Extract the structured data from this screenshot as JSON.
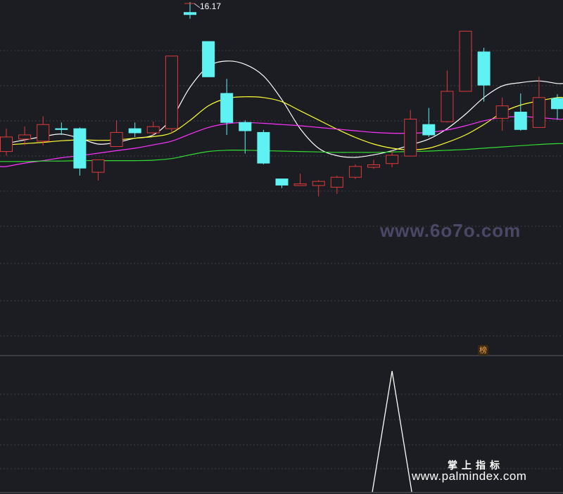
{
  "colors": {
    "background": "#1b1d22",
    "grid": "#3c3f46",
    "up": "#e03a3a",
    "down": "#5ef2f2",
    "ma5": "#ffffff",
    "ma10": "#ffff33",
    "ma20": "#ff33ff",
    "ma60": "#33dd33",
    "signal": "#ffffff"
  },
  "labels": {
    "high_marker": "16.17",
    "badge": "榜",
    "watermark_top": "www.6o7o.com",
    "watermark_cn": "掌上指标",
    "watermark_url": "www.palmindex.com"
  },
  "chart_data": [
    {
      "type": "candlestick",
      "title": "",
      "ylim": [
        7.9,
        16.4
      ],
      "high_label": 16.17,
      "candles": [
        {
          "o": 12.8,
          "c": 13.15,
          "h": 13.35,
          "l": 12.7
        },
        {
          "o": 13.1,
          "c": 13.2,
          "h": 13.4,
          "l": 12.95
        },
        {
          "o": 13.05,
          "c": 13.45,
          "h": 13.65,
          "l": 12.95
        },
        {
          "o": 13.35,
          "c": 13.33,
          "h": 13.5,
          "l": 13.2
        },
        {
          "o": 13.35,
          "c": 12.4,
          "h": 13.38,
          "l": 12.22
        },
        {
          "o": 12.3,
          "c": 12.6,
          "h": 12.6,
          "l": 12.1
        },
        {
          "o": 12.92,
          "c": 13.26,
          "h": 13.55,
          "l": 12.92
        },
        {
          "o": 13.35,
          "c": 13.25,
          "h": 13.5,
          "l": 13.15
        },
        {
          "o": 13.25,
          "c": 13.4,
          "h": 13.52,
          "l": 13.2
        },
        {
          "o": 13.35,
          "c": 15.1,
          "h": 15.1,
          "l": 13.25
        },
        {
          "o": 16.15,
          "c": 16.1,
          "h": 16.4,
          "l": 16.0
        },
        {
          "o": 15.45,
          "c": 14.6,
          "h": 15.45,
          "l": 14.6
        },
        {
          "o": 14.2,
          "c": 13.5,
          "h": 14.55,
          "l": 13.2
        },
        {
          "o": 13.5,
          "c": 13.3,
          "h": 13.55,
          "l": 12.75
        },
        {
          "o": 13.26,
          "c": 12.52,
          "h": 13.32,
          "l": 12.49
        },
        {
          "o": 12.14,
          "c": 11.99,
          "h": 12.14,
          "l": 11.92
        },
        {
          "o": 11.98,
          "c": 12.02,
          "h": 12.27,
          "l": 11.98
        },
        {
          "o": 11.98,
          "c": 12.08,
          "h": 12.11,
          "l": 11.72
        },
        {
          "o": 11.94,
          "c": 12.18,
          "h": 12.22,
          "l": 11.78
        },
        {
          "o": 12.18,
          "c": 12.44,
          "h": 12.49,
          "l": 12.14
        },
        {
          "o": 12.42,
          "c": 12.48,
          "h": 12.6,
          "l": 12.38
        },
        {
          "o": 12.51,
          "c": 12.71,
          "h": 12.82,
          "l": 12.42
        },
        {
          "o": 12.69,
          "c": 13.58,
          "h": 13.8,
          "l": 12.69
        },
        {
          "o": 13.45,
          "c": 13.2,
          "h": 13.85,
          "l": 13.15
        },
        {
          "o": 13.52,
          "c": 14.25,
          "h": 14.75,
          "l": 13.5
        },
        {
          "o": 14.25,
          "c": 15.7,
          "h": 15.7,
          "l": 14.4
        },
        {
          "o": 15.2,
          "c": 14.4,
          "h": 15.3,
          "l": 14.0
        },
        {
          "o": 13.6,
          "c": 13.9,
          "h": 14.1,
          "l": 13.3
        },
        {
          "o": 13.75,
          "c": 13.33,
          "h": 14.2,
          "l": 13.3
        },
        {
          "o": 13.38,
          "c": 14.1,
          "h": 14.6,
          "l": 13.38
        },
        {
          "o": 14.08,
          "c": 13.83,
          "h": 14.18,
          "l": 13.57
        }
      ],
      "series": [
        {
          "values": [
            13.0,
            13.08,
            13.16,
            13.22,
            13.12,
            12.98,
            13.02,
            13.12,
            13.2,
            13.6,
            14.35,
            14.85,
            14.98,
            14.9,
            14.62,
            14.05,
            13.35,
            12.88,
            12.7,
            12.66,
            12.72,
            12.82,
            12.96,
            13.1,
            13.35,
            13.7,
            14.1,
            14.38,
            14.46,
            14.5,
            14.44
          ]
        },
        {
          "values": [
            12.96,
            12.99,
            13.02,
            13.06,
            13.08,
            13.07,
            13.08,
            13.12,
            13.16,
            13.25,
            13.55,
            13.9,
            14.08,
            14.12,
            14.1,
            14.0,
            13.78,
            13.56,
            13.34,
            13.14,
            12.98,
            12.88,
            12.84,
            12.88,
            13.02,
            13.2,
            13.45,
            13.74,
            13.92,
            14.02,
            14.1
          ]
        },
        {
          "values": [
            12.44,
            12.52,
            12.58,
            12.65,
            12.7,
            12.76,
            12.82,
            12.88,
            12.96,
            13.05,
            13.22,
            13.38,
            13.47,
            13.5,
            13.48,
            13.45,
            13.42,
            13.38,
            13.34,
            13.3,
            13.26,
            13.24,
            13.24,
            13.26,
            13.32,
            13.42,
            13.54,
            13.62,
            13.64,
            13.62,
            13.58
          ]
        },
        {
          "values": [
            12.56,
            12.56,
            12.57,
            12.57,
            12.58,
            12.58,
            12.58,
            12.58,
            12.59,
            12.63,
            12.72,
            12.8,
            12.83,
            12.83,
            12.82,
            12.81,
            12.8,
            12.79,
            12.78,
            12.78,
            12.78,
            12.79,
            12.8,
            12.81,
            12.83,
            12.85,
            12.88,
            12.91,
            12.94,
            12.97,
            12.99
          ]
        }
      ]
    },
    {
      "type": "line",
      "title": "",
      "ylim": [
        0,
        1
      ],
      "series": [
        {
          "values": [
            0,
            0,
            0,
            0,
            0,
            0,
            0,
            0,
            0,
            0,
            0,
            0,
            0,
            0,
            0,
            0,
            0,
            0,
            0,
            0,
            0,
            1,
            0,
            0,
            0,
            0,
            0,
            0,
            0,
            0,
            0
          ]
        }
      ]
    }
  ]
}
